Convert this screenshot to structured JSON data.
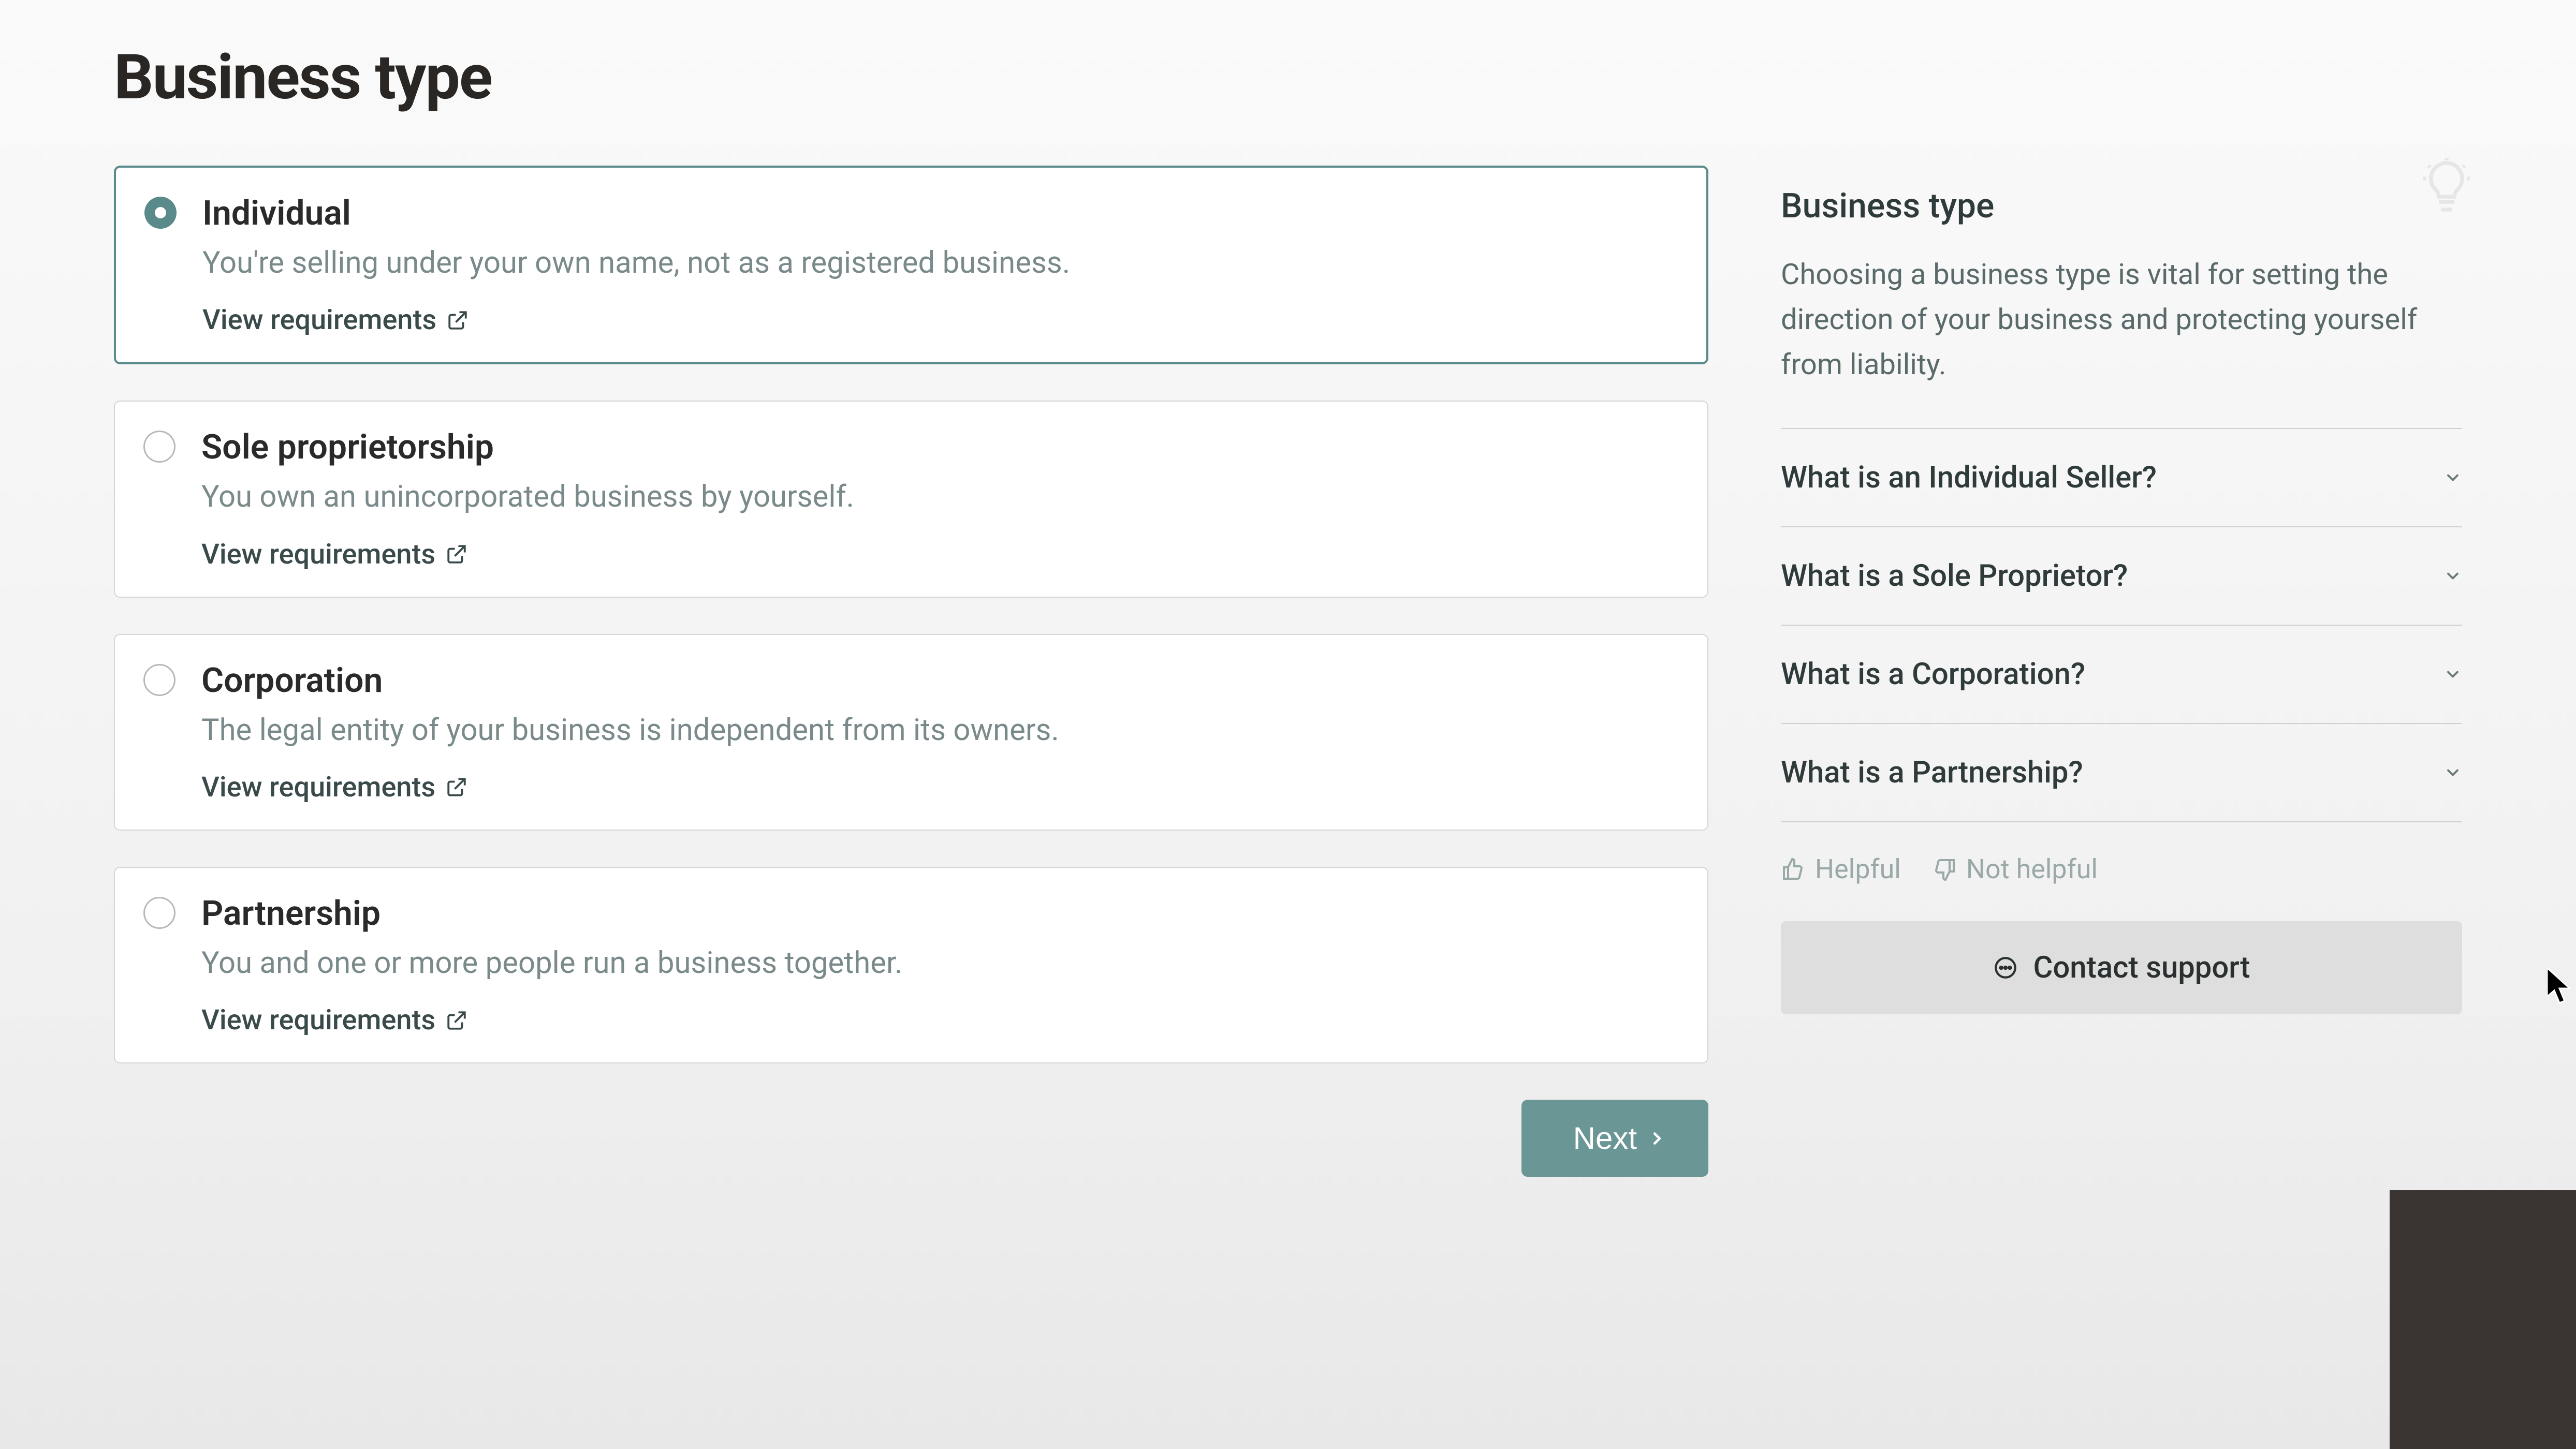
{
  "page": {
    "title": "Business type"
  },
  "options": [
    {
      "title": "Individual",
      "desc": "You're selling under your own name, not as a registered business.",
      "link": "View requirements",
      "selected": true
    },
    {
      "title": "Sole proprietorship",
      "desc": "You own an unincorporated business by yourself.",
      "link": "View requirements",
      "selected": false
    },
    {
      "title": "Corporation",
      "desc": "The legal entity of your business is independent from its owners.",
      "link": "View requirements",
      "selected": false
    },
    {
      "title": "Partnership",
      "desc": "You and one or more people run a business together.",
      "link": "View requirements",
      "selected": false
    }
  ],
  "next_label": "Next",
  "sidebar": {
    "title": "Business type",
    "desc": "Choosing a business type is vital for setting the direction of your business and protecting yourself from liability.",
    "faqs": [
      "What is an Individual Seller?",
      "What is a Sole Proprietor?",
      "What is a Corporation?",
      "What is a Partnership?"
    ],
    "helpful_label": "Helpful",
    "not_helpful_label": "Not helpful",
    "contact_label": "Contact support"
  }
}
